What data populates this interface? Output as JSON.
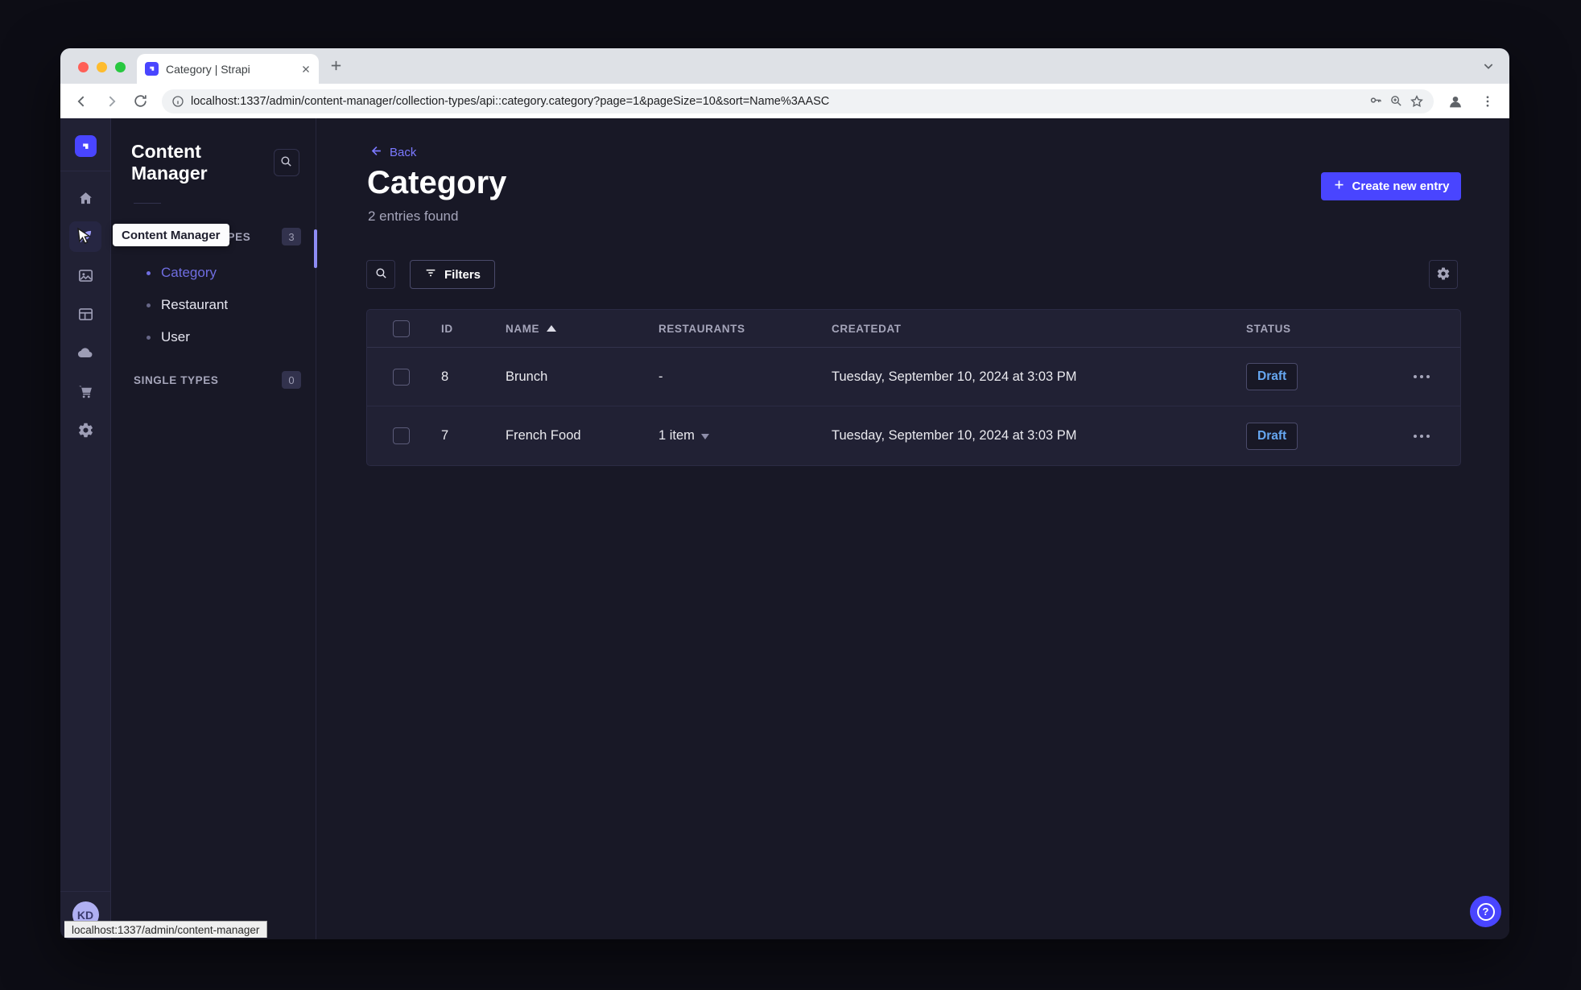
{
  "browser": {
    "tab_title": "Category | Strapi",
    "url": "localhost:1337/admin/content-manager/collection-types/api::category.category?page=1&pageSize=10&sort=Name%3AASC",
    "status_link": "localhost:1337/admin/content-manager",
    "icons": [
      "back-icon",
      "forward-icon",
      "reload-icon",
      "info-icon",
      "key-icon",
      "zoom-icon",
      "bookmark-star-icon",
      "profile-icon",
      "menu-kebab-icon",
      "new-tab-plus-icon",
      "tab-search-chevron-icon",
      "close-icon"
    ]
  },
  "colors": {
    "primary": "#4945ff",
    "primary_light": "#7b79ff",
    "app_background": "#181826",
    "surface": "#212134",
    "border": "#32324d",
    "text_muted": "#a5a5ba",
    "draft_text": "#66a7f1",
    "avatar_bg": "#b0b0f2"
  },
  "rail": {
    "icons": [
      "strapi-logo",
      "home-icon",
      "content-manager-icon",
      "media-library-icon",
      "content-type-builder-icon",
      "cloud-icon",
      "marketplace-cart-icon",
      "settings-gear-icon"
    ],
    "active_icon": "content-manager-icon",
    "user_initials": "KD"
  },
  "subnav": {
    "title": "Content Manager",
    "search_icon": "search-icon",
    "sections": [
      {
        "label": "COLLECTION TYPES",
        "badge": "3",
        "items": [
          {
            "label": "Category",
            "active": true
          },
          {
            "label": "Restaurant",
            "active": false
          },
          {
            "label": "User",
            "active": false
          }
        ]
      },
      {
        "label": "SINGLE TYPES",
        "badge": "0",
        "items": []
      }
    ]
  },
  "tooltip": {
    "text": "Content Manager"
  },
  "main": {
    "back_label": "Back",
    "title": "Category",
    "subtitle": "2 entries found",
    "create_button_label": "Create new entry",
    "filters_button_label": "Filters",
    "settings_icon": "gear-icon",
    "table": {
      "columns": {
        "id": "ID",
        "name": "NAME",
        "restaurants": "RESTAURANTS",
        "createdat": "CREATEDAT",
        "status": "STATUS"
      },
      "sort": {
        "column": "NAME",
        "direction": "asc"
      },
      "rows": [
        {
          "id": "8",
          "name": "Brunch",
          "restaurants": "-",
          "has_restaurants_dropdown": false,
          "createdat": "Tuesday, September 10, 2024 at 3:03 PM",
          "status": "Draft"
        },
        {
          "id": "7",
          "name": "French Food",
          "restaurants": "1 item",
          "has_restaurants_dropdown": true,
          "createdat": "Tuesday, September 10, 2024 at 3:03 PM",
          "status": "Draft"
        }
      ]
    },
    "help_button_icon": "help-question-icon"
  }
}
